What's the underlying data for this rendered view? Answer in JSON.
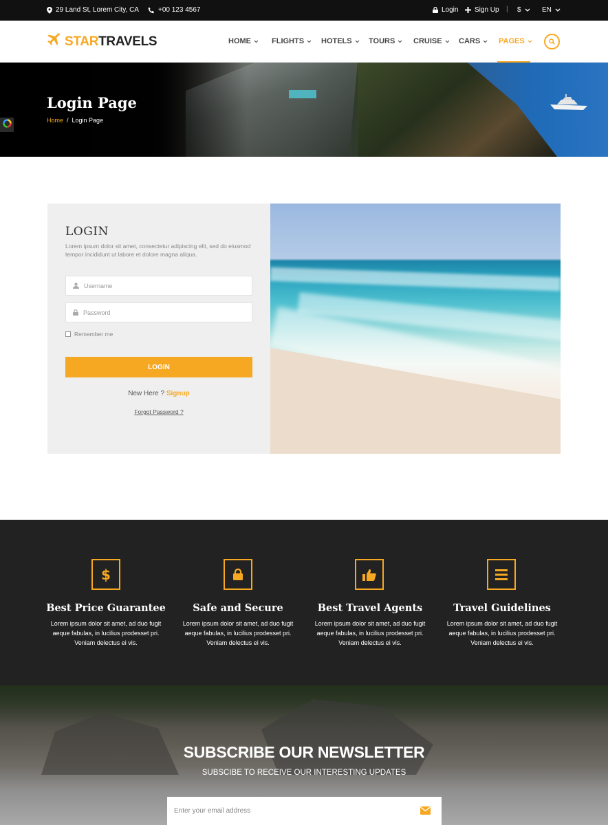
{
  "topbar": {
    "address": "29 Land St, Lorem City, CA",
    "phone": "+00 123 4567",
    "login": "Login",
    "signup": "Sign Up",
    "currency": "$",
    "language": "EN"
  },
  "brand": {
    "part1": "STAR",
    "part2": "TRAVELS"
  },
  "nav": {
    "items": [
      {
        "label": "HOME"
      },
      {
        "label": "FLIGHTS"
      },
      {
        "label": "HOTELS"
      },
      {
        "label": "TOURS"
      },
      {
        "label": "CRUISE"
      },
      {
        "label": "CARS"
      },
      {
        "label": "PAGES",
        "active": true
      }
    ]
  },
  "hero": {
    "title": "Login Page",
    "breadcrumb": {
      "home": "Home",
      "separator": "/",
      "current": "Login Page"
    }
  },
  "login": {
    "title": "LOGIN",
    "description": "Lorem ipsum dolor sit amet, consectetur adipiscing elit, sed do eiusmod tempor incididunt ut labore et dolore magna aliqua.",
    "username_placeholder": "Username",
    "password_placeholder": "Password",
    "remember": "Remember me",
    "button": "LOGIN",
    "new_here": "New Here ?",
    "signup": "Signup",
    "forgot": "Forgot Password ?"
  },
  "features": [
    {
      "icon": "dollar-icon",
      "title": "Best Price Guarantee",
      "text": "Lorem ipsum dolor sit amet, ad duo fugit aeque fabulas, in lucilius prodesset pri. Veniam delectus ei vis."
    },
    {
      "icon": "lock-icon",
      "title": "Safe and Secure",
      "text": "Lorem ipsum dolor sit amet, ad duo fugit aeque fabulas, in lucilius prodesset pri. Veniam delectus ei vis."
    },
    {
      "icon": "thumbs-up-icon",
      "title": "Best Travel Agents",
      "text": "Lorem ipsum dolor sit amet, ad duo fugit aeque fabulas, in lucilius prodesset pri. Veniam delectus ei vis."
    },
    {
      "icon": "list-icon",
      "title": "Travel Guidelines",
      "text": "Lorem ipsum dolor sit amet, ad duo fugit aeque fabulas, in lucilius prodesset pri. Veniam delectus ei vis."
    }
  ],
  "newsletter": {
    "title": "SUBSCRIBE OUR NEWSLETTER",
    "subtitle": "SUBSCIBE TO RECEIVE OUR INTERESTING UPDATES",
    "placeholder": "Enter your email address"
  },
  "colors": {
    "accent": "#f7a823",
    "topbar": "#111111",
    "features_bg": "#222222"
  }
}
